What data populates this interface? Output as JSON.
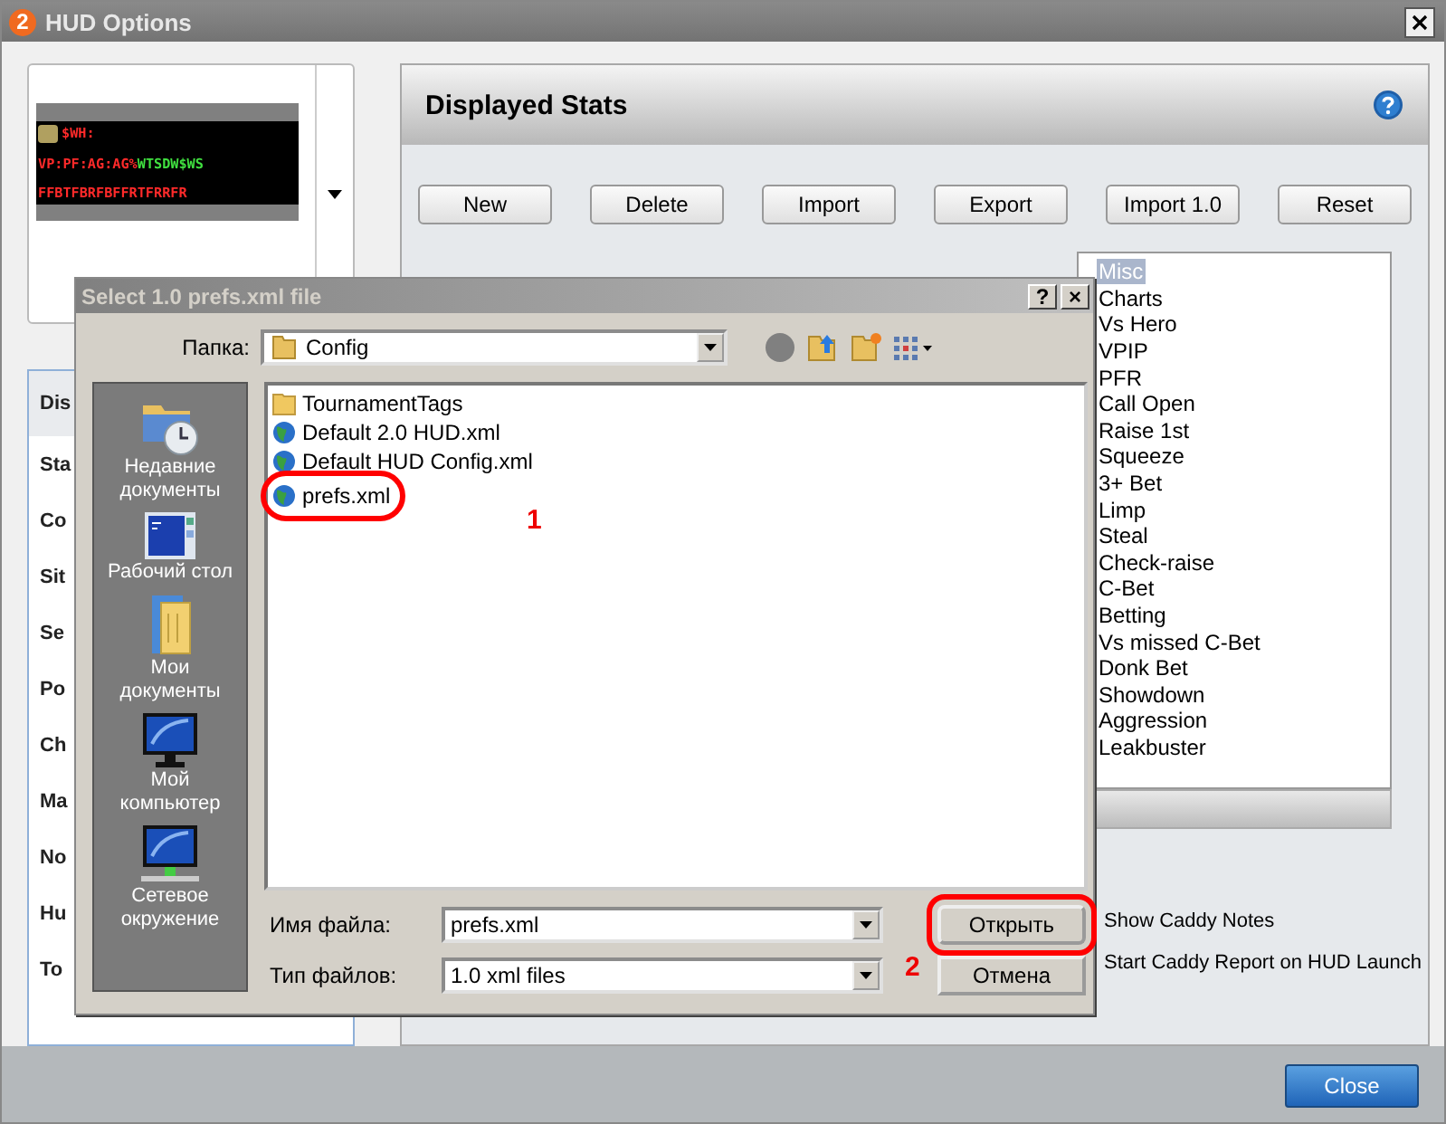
{
  "window": {
    "badge": "2",
    "title": "HUD Options"
  },
  "hud_preview": {
    "line_1": "$WH:",
    "line_2_red": "VP:PF:AG:AG%",
    "line_2_green": "WTSDW$WS",
    "line_3": "FFBTFBRFBFFRTFRRFR"
  },
  "sidebar": {
    "items": [
      {
        "label": "Dis",
        "selected": true
      },
      {
        "label": "Sta",
        "selected": false
      },
      {
        "label": "Co",
        "selected": false
      },
      {
        "label": "Sit",
        "selected": false
      },
      {
        "label": "Se",
        "selected": false
      },
      {
        "label": "Po",
        "selected": false
      },
      {
        "label": "Ch",
        "selected": false
      },
      {
        "label": "Ma",
        "selected": false
      },
      {
        "label": "No",
        "selected": false
      },
      {
        "label": "Hu",
        "selected": false
      },
      {
        "label": "To",
        "selected": false
      }
    ]
  },
  "panel": {
    "title": "Displayed Stats",
    "buttons": [
      "New",
      "Delete",
      "Import",
      "Export",
      "Import 1.0",
      "Reset"
    ],
    "stats": [
      {
        "label": "Misc",
        "selected": true
      },
      {
        "label": "Charts",
        "selected": false
      },
      {
        "label": "Vs Hero",
        "selected": false
      },
      {
        "label": "VPIP",
        "selected": false
      },
      {
        "label": "PFR",
        "selected": false
      },
      {
        "label": "Call Open",
        "selected": false
      },
      {
        "label": "Raise 1st",
        "selected": false
      },
      {
        "label": "Squeeze",
        "selected": false
      },
      {
        "label": "3+ Bet",
        "selected": false
      },
      {
        "label": "Limp",
        "selected": false
      },
      {
        "label": "Steal",
        "selected": false
      },
      {
        "label": "Check-raise",
        "selected": false
      },
      {
        "label": "C-Bet",
        "selected": false
      },
      {
        "label": "Betting",
        "selected": false
      },
      {
        "label": "Vs missed C-Bet",
        "selected": false
      },
      {
        "label": "Donk Bet",
        "selected": false
      },
      {
        "label": "Showdown",
        "selected": false
      },
      {
        "label": "Aggression",
        "selected": false
      },
      {
        "label": "Leakbuster",
        "selected": false
      }
    ],
    "options": [
      "Show Caddy Notes",
      "Start Caddy Report on HUD Launch"
    ]
  },
  "close_button": "Close",
  "dialog": {
    "title": "Select 1.0 prefs.xml file",
    "help_button": "?",
    "close_button": "×",
    "folder_label": "Папка:",
    "folder": "Config",
    "places": [
      {
        "kind": "recent",
        "label": "Недавние документы"
      },
      {
        "kind": "desktop",
        "label": "Рабочий стол"
      },
      {
        "kind": "documents",
        "label": "Мои документы"
      },
      {
        "kind": "computer",
        "label": "Мой компьютер"
      },
      {
        "kind": "network",
        "label": "Сетевое окружение"
      }
    ],
    "files": [
      {
        "kind": "folder",
        "name": "TournamentTags",
        "circled": false
      },
      {
        "kind": "xml",
        "name": "Default 2.0 HUD.xml",
        "circled": false
      },
      {
        "kind": "xml",
        "name": "Default HUD Config.xml",
        "circled": false
      },
      {
        "kind": "xml",
        "name": "prefs.xml",
        "circled": true
      }
    ],
    "file_name_label": "Имя файла:",
    "file_name": "prefs.xml",
    "file_type_label": "Тип файлов:",
    "file_type": "1.0 xml files",
    "open_button": "Открыть",
    "open_button_circled": true,
    "cancel_button": "Отмена"
  },
  "annotations": [
    "1",
    "2"
  ]
}
